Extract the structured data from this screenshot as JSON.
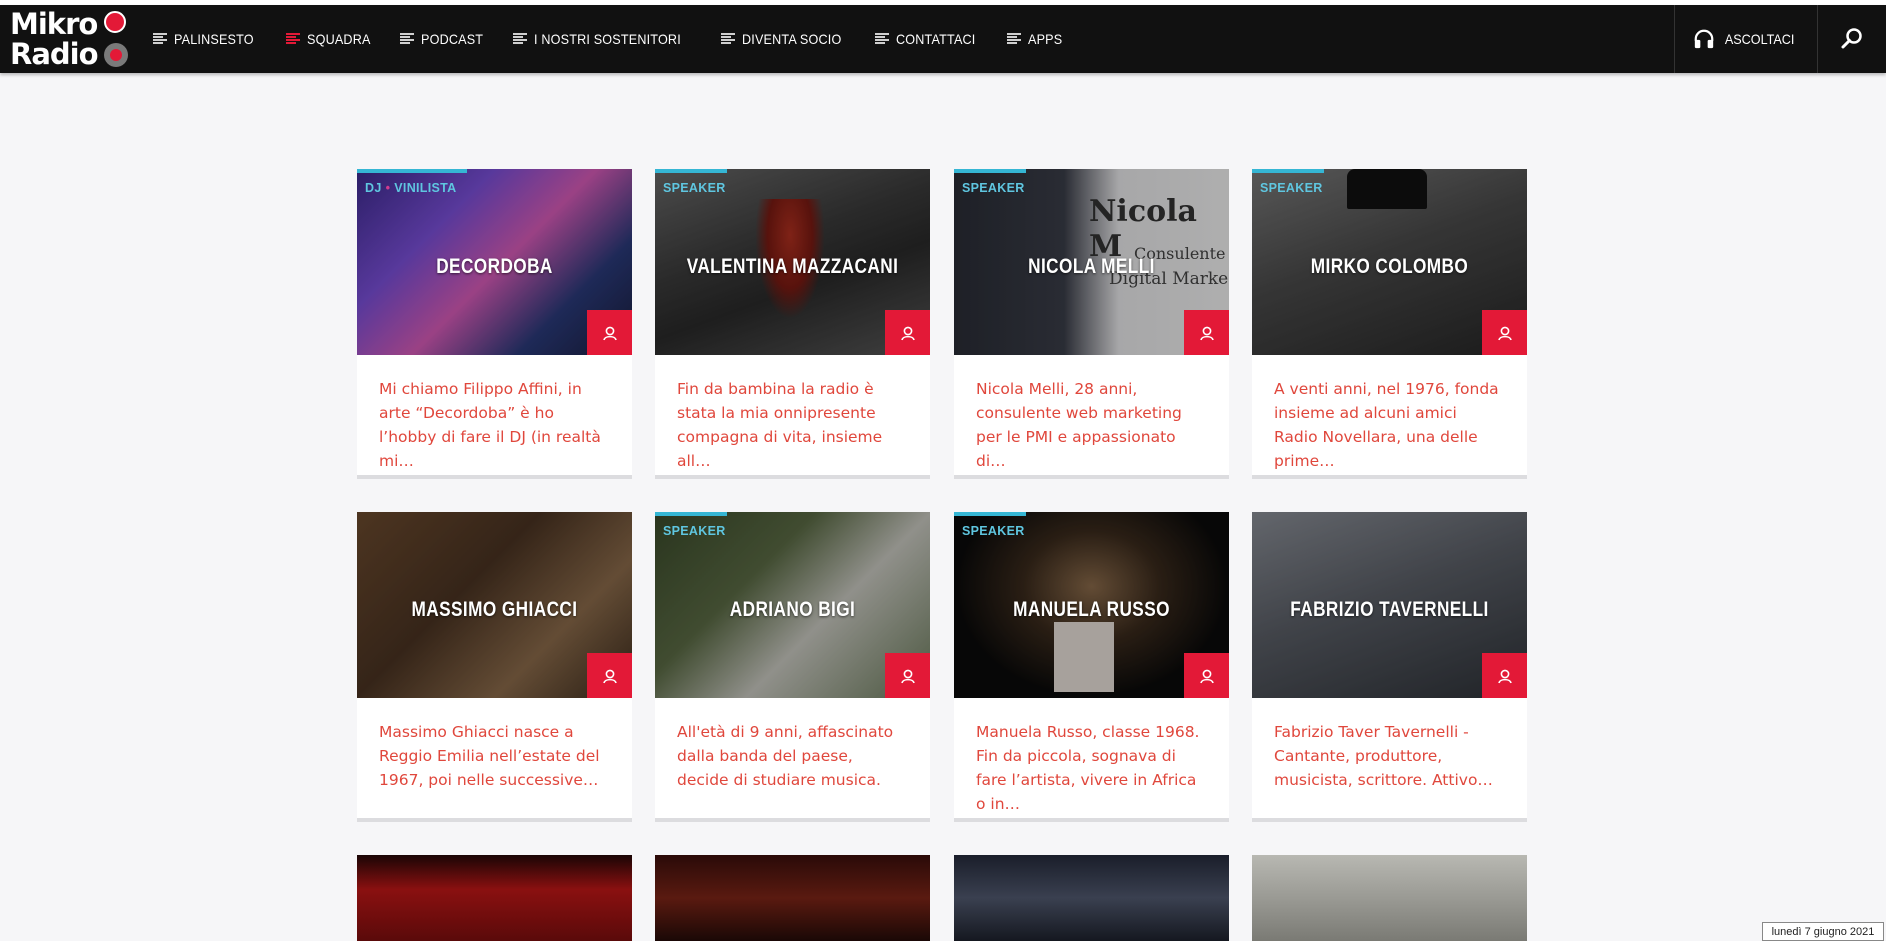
{
  "nav": {
    "logo_line1": "Mikro",
    "logo_line2": "Radio",
    "items": [
      {
        "label": "PALINSESTO",
        "active": false
      },
      {
        "label": "SQUADRA",
        "active": true
      },
      {
        "label": "PODCAST",
        "active": false
      },
      {
        "label": "I NOSTRI SOSTENITORI",
        "active": false
      },
      {
        "label": "DIVENTA SOCIO",
        "active": false
      },
      {
        "label": "CONTATTACI",
        "active": false
      },
      {
        "label": "APPS",
        "active": false
      }
    ],
    "listen_label": "ASCOLTACI",
    "listen_icon": "headphones-icon",
    "search_icon": "search-icon"
  },
  "colors": {
    "accent": "#e31937",
    "tag": "#35b6d4",
    "excerpt": "#e0473c",
    "nav_bg": "#111111"
  },
  "cards": [
    {
      "tag": "DJ",
      "tag2": "VINILISTA",
      "name": "DECORDOBA",
      "excerpt": "Mi chiamo Filippo Affini, in arte “Decordoba” è ho l’hobby di fare il DJ (in realtà mi…"
    },
    {
      "tag": "SPEAKER",
      "name": "VALENTINA MAZZACANI",
      "excerpt": "Fin da bambina la radio è stata la mia onnipresente compagna di vita, insieme all…"
    },
    {
      "tag": "SPEAKER",
      "name": "NICOLA MELLI",
      "photo_text1": "Nicola M",
      "photo_text2": "Consulente",
      "photo_text3": "Digital Marke",
      "excerpt": "Nicola Melli, 28 anni, consulente web marketing per le PMI e appassionato di…"
    },
    {
      "tag": "SPEAKER",
      "name": "MIRKO COLOMBO",
      "excerpt": "A venti anni, nel 1976, fonda insieme ad alcuni amici Radio Novellara, una delle prime…"
    },
    {
      "tag": "",
      "name": "MASSIMO GHIACCI",
      "excerpt": "Massimo Ghiacci nasce a Reggio Emilia nell’estate del 1967, poi nelle successive…"
    },
    {
      "tag": "SPEAKER",
      "name": "ADRIANO BIGI",
      "excerpt": "All'età di 9 anni, affascinato dalla  banda del paese, decide di studiare musica."
    },
    {
      "tag": "SPEAKER",
      "name": "MANUELA RUSSO",
      "excerpt": "Manuela Russo, classe 1968. Fin da piccola, sognava di fare l’artista, vivere in Africa o in…"
    },
    {
      "tag": "",
      "name": "FABRIZIO TAVERNELLI",
      "excerpt": "Fabrizio Taver Tavernelli - Cantante, produttore, musicista, scrittore. Attivo…"
    }
  ],
  "date_text": "lunedì 7 giugno 2021"
}
